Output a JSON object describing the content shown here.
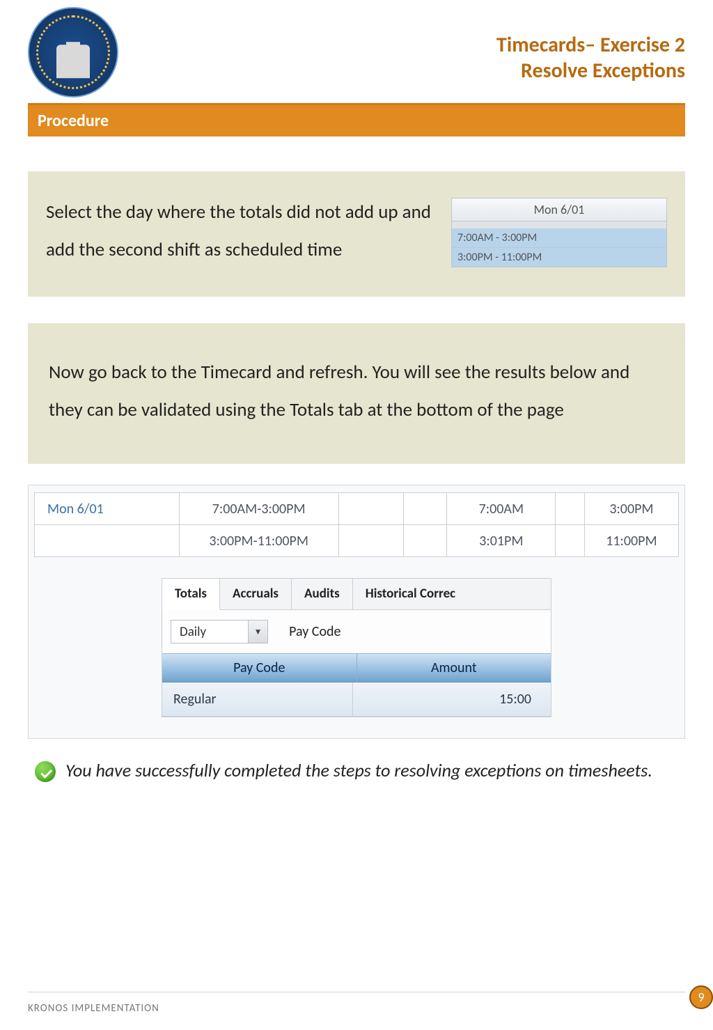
{
  "header": {
    "title_line1": "Timecards– Exercise 2",
    "title_line2": "Resolve Exceptions",
    "procedure_label": "Procedure"
  },
  "step1": {
    "text": "Select the day where the totals did not add up and add the second shift as scheduled time",
    "schedule": {
      "date": "Mon 6/01",
      "rows": [
        "7:00AM - 3:00PM",
        "3:00PM - 11:00PM"
      ]
    }
  },
  "step2": {
    "text": "Now go back to the Timecard and refresh. You will see the results below and they can be validated using the Totals tab at the bottom of the page"
  },
  "timecard": {
    "rows": [
      {
        "date": "Mon 6/01",
        "sched": "7:00AM-3:00PM",
        "in": "7:00AM",
        "out": "3:00PM"
      },
      {
        "date": "",
        "sched": "3:00PM-11:00PM",
        "in": "3:01PM",
        "out": "11:00PM"
      }
    ]
  },
  "totals_panel": {
    "tabs": [
      "Totals",
      "Accruals",
      "Audits",
      "Historical Correc"
    ],
    "dropdown_value": "Daily",
    "filter_label": "Pay Code",
    "columns": [
      "Pay Code",
      "Amount"
    ],
    "row": {
      "paycode": "Regular",
      "amount": "15:00"
    }
  },
  "success": {
    "text": "You have successfully completed the steps to resolving exceptions on timesheets."
  },
  "footer": {
    "label": "KRONOS IMPLEMENTATION",
    "page": "9"
  }
}
